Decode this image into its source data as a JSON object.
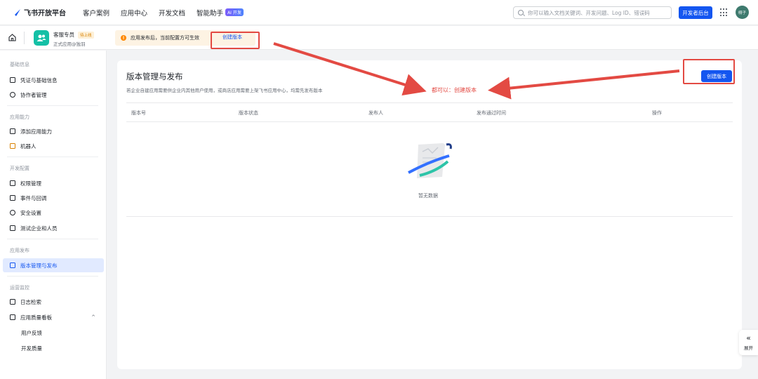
{
  "topbar": {
    "logo_text": "飞书开放平台",
    "nav": [
      "客户案例",
      "应用中心",
      "开发文档",
      "智能助手"
    ],
    "ai_badge": "AI 开发",
    "search_placeholder": "你可以输入文档关键词、开发问题、Log ID、错误码",
    "dev_console_label": "开发者后台",
    "avatar_text": "栩子"
  },
  "app_header": {
    "app_name": "客服专员",
    "status_badge": "待上线",
    "app_sub": "正式应用@独羽",
    "notice_text": "应用发布后，当前配置方可生效",
    "notice_link": "创建版本"
  },
  "sidebar": {
    "groups": [
      {
        "title": "基础信息",
        "items": [
          "凭证与基础信息",
          "协作者管理"
        ]
      },
      {
        "title": "应用能力",
        "items": [
          "添加应用能力",
          "机器人"
        ]
      },
      {
        "title": "开发配置",
        "items": [
          "权限管理",
          "事件与回调",
          "安全设置",
          "测试企业和人员"
        ]
      },
      {
        "title": "应用发布",
        "items": [
          "版本管理与发布"
        ]
      },
      {
        "title": "运营监控",
        "items": [
          "日志检索",
          "应用质量看板"
        ],
        "sub_items": [
          "用户反馈",
          "开发质量"
        ]
      }
    ],
    "active_item": "版本管理与发布"
  },
  "main": {
    "title": "版本管理与发布",
    "description": "若企业自建应用需要供企业内其他用户使用，或商店应用需要上架飞书应用中心，均需先发布版本",
    "create_button": "创建版本",
    "annotation": "都可以：创建版本",
    "table_headers": [
      "版本号",
      "版本状态",
      "发布人",
      "发布通过时间",
      "操作"
    ],
    "empty_text": "暂无数据"
  },
  "expand_panel": {
    "label": "展开"
  },
  "colors": {
    "brand": "#1456f0",
    "annotation": "#e34a43",
    "active_bg": "#e1eaff"
  }
}
